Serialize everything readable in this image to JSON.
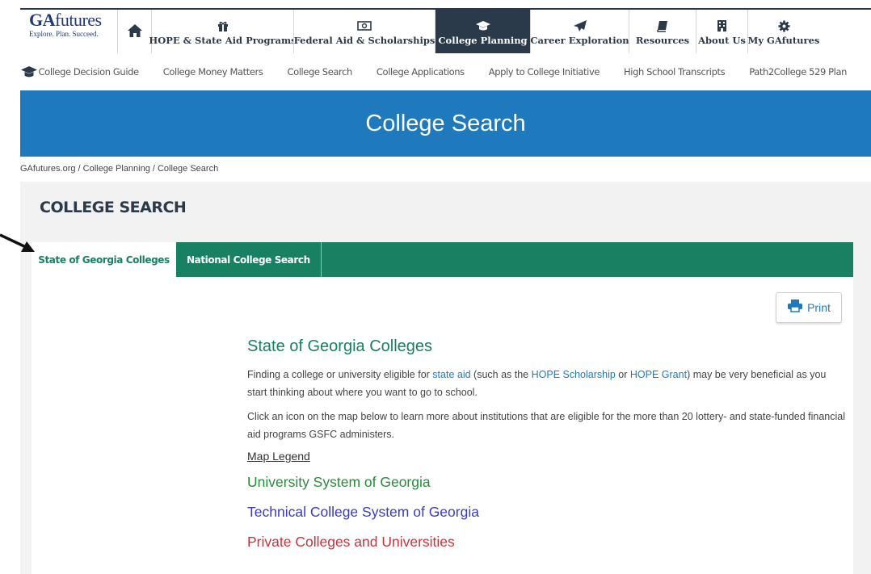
{
  "logo": {
    "name": "GAfutures",
    "name_bold": "GA",
    "name_rest": "futures",
    "tagline": "Explore. Plan. Succeed."
  },
  "topnav": {
    "items": [
      {
        "label": "",
        "icon": "home-icon"
      },
      {
        "label": "HOPE & State Aid Programs",
        "icon": "gift-icon"
      },
      {
        "label": "Federal Aid & Scholarships",
        "icon": "money-icon"
      },
      {
        "label": "College Planning",
        "icon": "graduation-cap-icon",
        "active": true
      },
      {
        "label": "Career Exploration",
        "icon": "paper-plane-icon"
      },
      {
        "label": "Resources",
        "icon": "book-icon"
      },
      {
        "label": "About Us",
        "icon": "building-icon"
      },
      {
        "label": "My GAfutures",
        "icon": "gear-icon"
      }
    ]
  },
  "subnav": {
    "items": [
      "College Decision Guide",
      "College Money Matters",
      "College Search",
      "College Applications",
      "Apply to College Initiative",
      "High School Transcripts",
      "Path2College 529 Plan"
    ]
  },
  "banner": {
    "title": "College Search"
  },
  "breadcrumb": "GAfutures.org / College Planning / College Search",
  "section_title": "COLLEGE SEARCH",
  "tabs": [
    {
      "label": "State of Georgia Colleges",
      "active": true
    },
    {
      "label": "National College Search",
      "active": false
    }
  ],
  "print_button": {
    "label": "Print"
  },
  "content": {
    "heading": "State of Georgia Colleges",
    "p1_a": "Finding a college or university eligible for ",
    "p1_link1": "state aid",
    "p1_b": " (such as the ",
    "p1_link2": "HOPE Scholarship",
    "p1_c": " or ",
    "p1_link3": "HOPE Grant",
    "p1_d": ") may be very beneficial as you start thinking about where you want to go to school.",
    "p2": "Click an icon on the map below to learn more about institutions that are eligible for the more than 20 lottery- and state-funded financial aid programs GSFC administers.",
    "legend_title": "Map Legend",
    "legend": [
      {
        "label": "University System of Georgia",
        "color": "#2a8a3a"
      },
      {
        "label": "Technical College System of Georgia",
        "color": "#3a3ac8"
      },
      {
        "label": "Private Colleges and Universities",
        "color": "#c8343a"
      }
    ]
  },
  "colors": {
    "navy": "#2b3a4a",
    "banner_blue": "#1e7abd",
    "tab_green": "#178162",
    "gray_bg": "#f2f2f2"
  }
}
